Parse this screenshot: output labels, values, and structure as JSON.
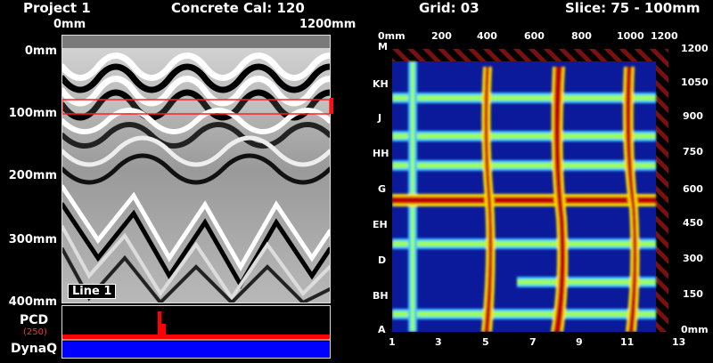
{
  "header": {
    "project": "Project 1",
    "calibration": "Concrete Cal: 120",
    "grid": "Grid: 03",
    "slice": "Slice: 75 - 100mm"
  },
  "bscan": {
    "x_start": "0mm",
    "x_end": "1200mm",
    "depth_labels": [
      "0mm",
      "100mm",
      "200mm",
      "300mm",
      "400mm"
    ],
    "line_label": "Line 1",
    "slice_highlight_mm": [
      75,
      100
    ]
  },
  "bottom_panel": {
    "pcd_label": "PCD",
    "pcd_value": "(250)",
    "dynaq_label": "DynaQ",
    "colors": {
      "pcd": "#ff0000",
      "dynaq": "#0000ff"
    }
  },
  "cscan": {
    "top_axis": [
      "0mm",
      "200",
      "400",
      "600",
      "800",
      "1000",
      "1200"
    ],
    "right_axis": [
      "1200",
      "1050",
      "900",
      "750",
      "600",
      "450",
      "300",
      "150",
      "0mm"
    ],
    "left_axis": [
      "M",
      "KH",
      "J",
      "HH",
      "G",
      "EH",
      "D",
      "BH",
      "A"
    ],
    "bottom_axis": [
      "1",
      "3",
      "5",
      "7",
      "9",
      "11",
      "13"
    ]
  }
}
